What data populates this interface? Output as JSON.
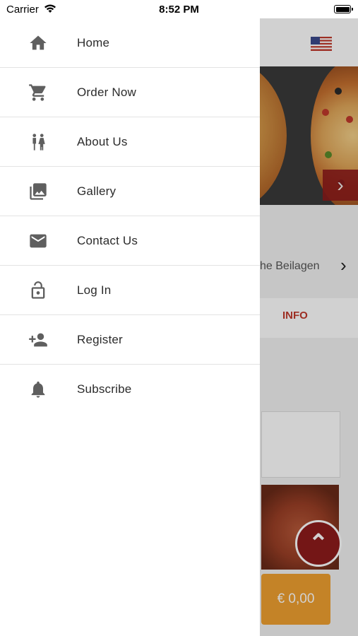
{
  "status_bar": {
    "carrier": "Carrier",
    "time": "8:52 PM"
  },
  "menu": {
    "items": [
      {
        "label": "Home",
        "icon": "home-icon"
      },
      {
        "label": "Order Now",
        "icon": "cart-icon"
      },
      {
        "label": "About Us",
        "icon": "people-icon"
      },
      {
        "label": "Gallery",
        "icon": "gallery-icon"
      },
      {
        "label": "Contact Us",
        "icon": "mail-icon"
      },
      {
        "label": "Log In",
        "icon": "lock-icon"
      },
      {
        "label": "Register",
        "icon": "add-user-icon"
      },
      {
        "label": "Subscribe",
        "icon": "bell-icon"
      }
    ]
  },
  "background": {
    "category_label": "he Beilagen",
    "tab_label": "INFO",
    "cart_total": "€ 0,00",
    "language_flag": "us-flag-icon",
    "colors": {
      "accent": "#8e1b1b",
      "cart": "#f0a030",
      "icon": "#5f5f5f"
    }
  }
}
